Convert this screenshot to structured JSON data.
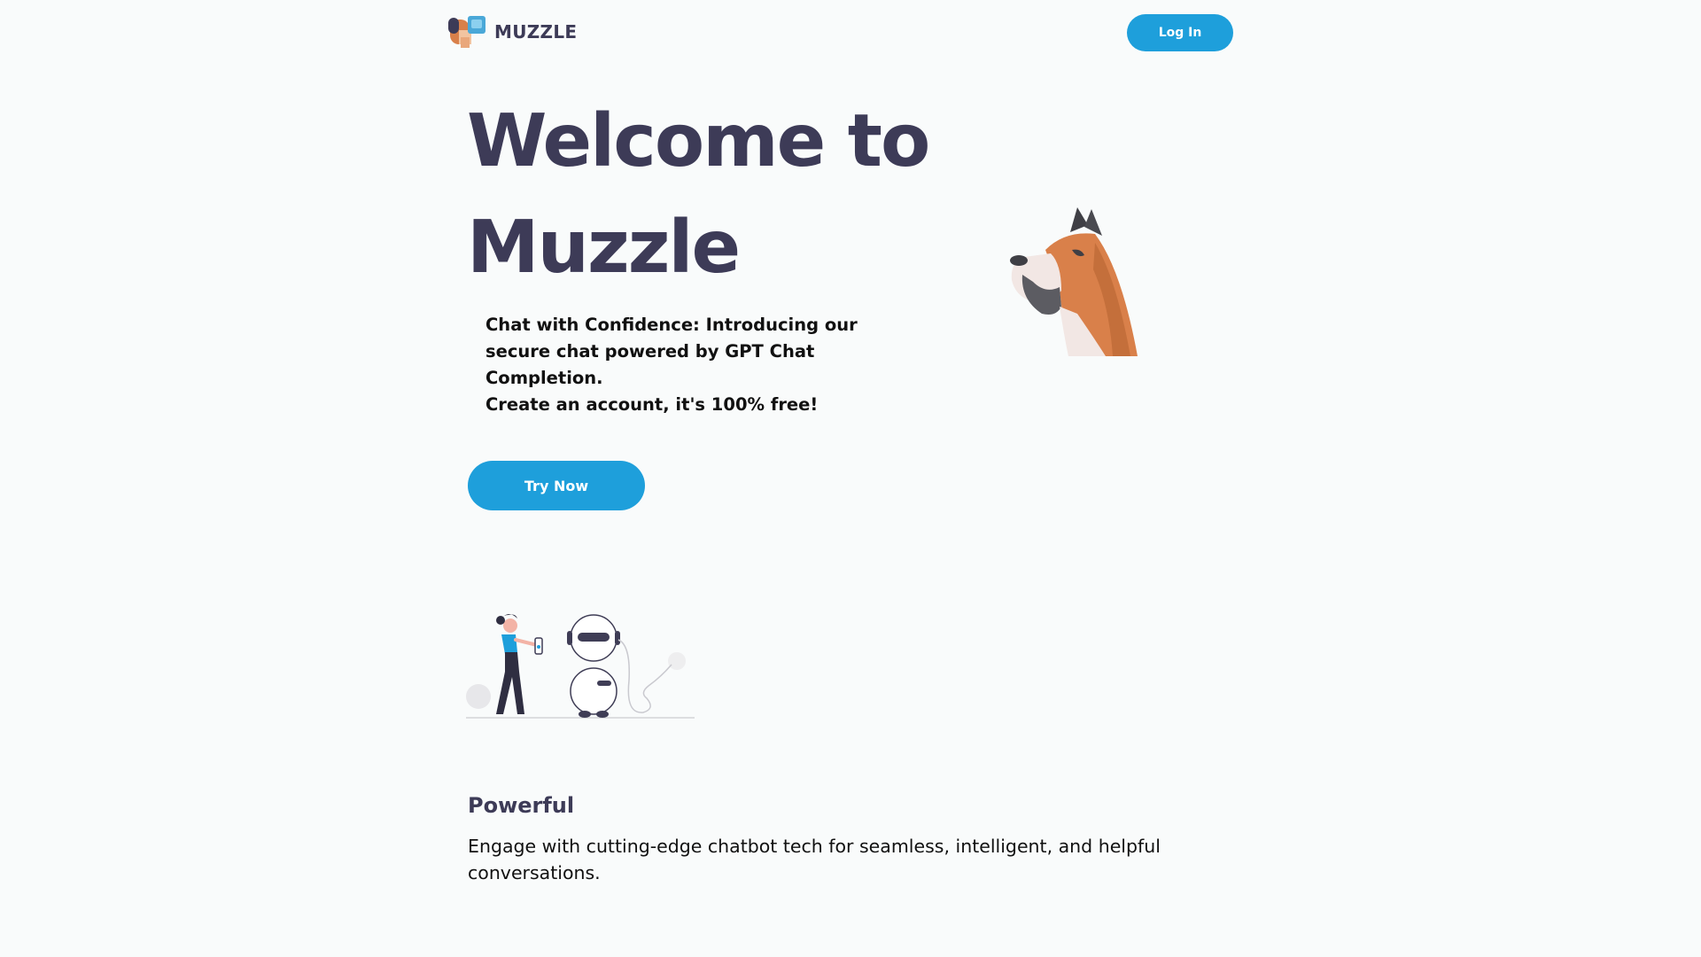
{
  "header": {
    "brand_name": "MUZZLE",
    "login_label": "Log In"
  },
  "hero": {
    "title_line1": "Welcome to",
    "title_line2": "Muzzle",
    "tagline_line1": "Chat with Confidence: Introducing our secure chat powered by GPT Chat Completion.",
    "tagline_line2": "Create an account, it's 100% free!",
    "cta_label": "Try Now"
  },
  "feature": {
    "title": "Powerful",
    "description": "Engage with cutting-edge chatbot tech for seamless, intelligent, and helpful conversations."
  },
  "colors": {
    "background": "#f9fbfb",
    "accent": "#1e9fdb",
    "heading": "#3d3b57",
    "dog_orange": "#d9804a"
  },
  "icons": {
    "logo": "muzzle-dog-logo-icon",
    "hero_art": "dog-head-illustration",
    "bottom_art": "person-robot-illustration"
  }
}
